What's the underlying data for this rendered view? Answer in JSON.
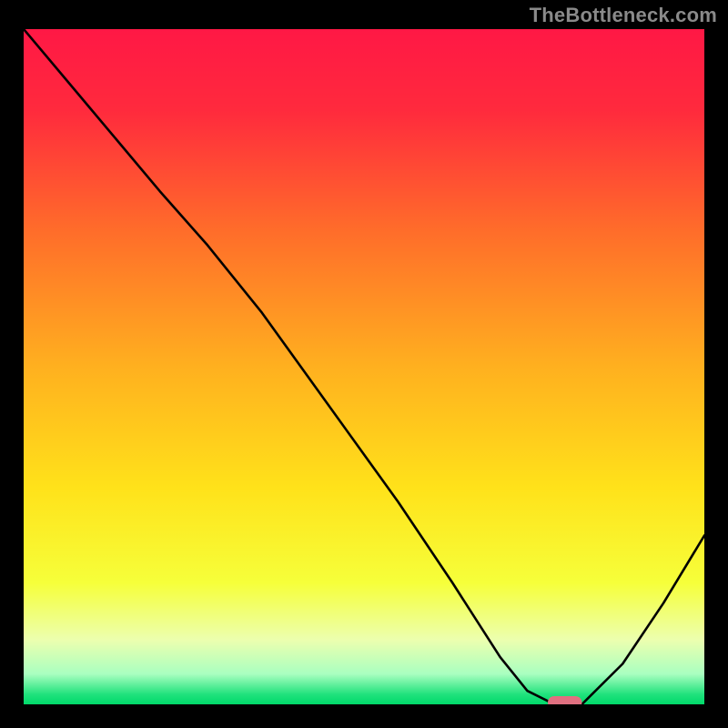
{
  "watermark": "TheBottleneck.com",
  "chart_data": {
    "type": "line",
    "title": "",
    "xlabel": "",
    "ylabel": "",
    "xlim": [
      0,
      100
    ],
    "ylim": [
      0,
      100
    ],
    "grid": false,
    "legend": false,
    "background_gradient": {
      "stops": [
        {
          "pos": 0.0,
          "color": "#ff1845"
        },
        {
          "pos": 0.12,
          "color": "#ff2a3d"
        },
        {
          "pos": 0.3,
          "color": "#ff6d2a"
        },
        {
          "pos": 0.5,
          "color": "#ffb01f"
        },
        {
          "pos": 0.68,
          "color": "#ffe21a"
        },
        {
          "pos": 0.82,
          "color": "#f6ff3a"
        },
        {
          "pos": 0.905,
          "color": "#ecffaf"
        },
        {
          "pos": 0.955,
          "color": "#a9ffc0"
        },
        {
          "pos": 0.985,
          "color": "#21e27d"
        },
        {
          "pos": 1.0,
          "color": "#00d96a"
        }
      ]
    },
    "series": [
      {
        "name": "bottleneck-curve",
        "x": [
          0,
          10,
          20,
          27,
          35,
          45,
          55,
          63,
          70,
          74,
          78,
          82,
          88,
          94,
          100
        ],
        "values": [
          100,
          88,
          76,
          68,
          58,
          44,
          30,
          18,
          7,
          2,
          0,
          0,
          6,
          15,
          25
        ]
      }
    ],
    "marker": {
      "name": "optimal-point",
      "x": 79.5,
      "y": 0,
      "width": 5,
      "color": "#e07080"
    }
  }
}
